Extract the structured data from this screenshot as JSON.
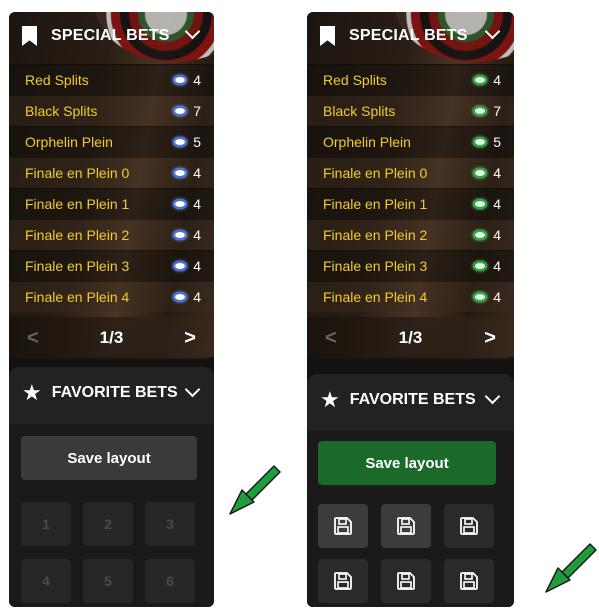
{
  "panels": [
    {
      "special": {
        "title": "SPECIAL BETS",
        "items": [
          {
            "label": "Red Splits",
            "count": "4"
          },
          {
            "label": "Black Splits",
            "count": "7"
          },
          {
            "label": "Orphelin Plein",
            "count": "5"
          },
          {
            "label": "Finale en Plein 0",
            "count": "4"
          },
          {
            "label": "Finale en Plein 1",
            "count": "4"
          },
          {
            "label": "Finale en Plein 2",
            "count": "4"
          },
          {
            "label": "Finale en Plein 3",
            "count": "4"
          },
          {
            "label": "Finale en Plein 4",
            "count": "4"
          }
        ],
        "pager": {
          "prev": "<",
          "page": "1/3",
          "next": ">"
        }
      },
      "favorite": {
        "title": "FAVORITE BETS",
        "save_label": "Save layout",
        "slots": [
          "1",
          "2",
          "3",
          "4",
          "5",
          "6"
        ]
      }
    },
    {
      "special": {
        "title": "SPECIAL BETS",
        "items": [
          {
            "label": "Red Splits",
            "count": "4"
          },
          {
            "label": "Black Splits",
            "count": "7"
          },
          {
            "label": "Orphelin Plein",
            "count": "5"
          },
          {
            "label": "Finale en Plein 0",
            "count": "4"
          },
          {
            "label": "Finale en Plein 1",
            "count": "4"
          },
          {
            "label": "Finale en Plein 2",
            "count": "4"
          },
          {
            "label": "Finale en Plein 3",
            "count": "4"
          },
          {
            "label": "Finale en Plein 4",
            "count": "4"
          }
        ],
        "pager": {
          "prev": "<",
          "page": "1/3",
          "next": ">"
        }
      },
      "favorite": {
        "title": "FAVORITE BETS",
        "save_label": "Save layout",
        "slots_icon": "floppy-disk-icon"
      }
    }
  ],
  "colors": {
    "item_label": "#f2cc2e",
    "chip_left": "#3d6cf0",
    "chip_right": "#1faa3e",
    "save_button_active": "#1b6a2a",
    "annotation_arrow": "#1e9e3a"
  }
}
